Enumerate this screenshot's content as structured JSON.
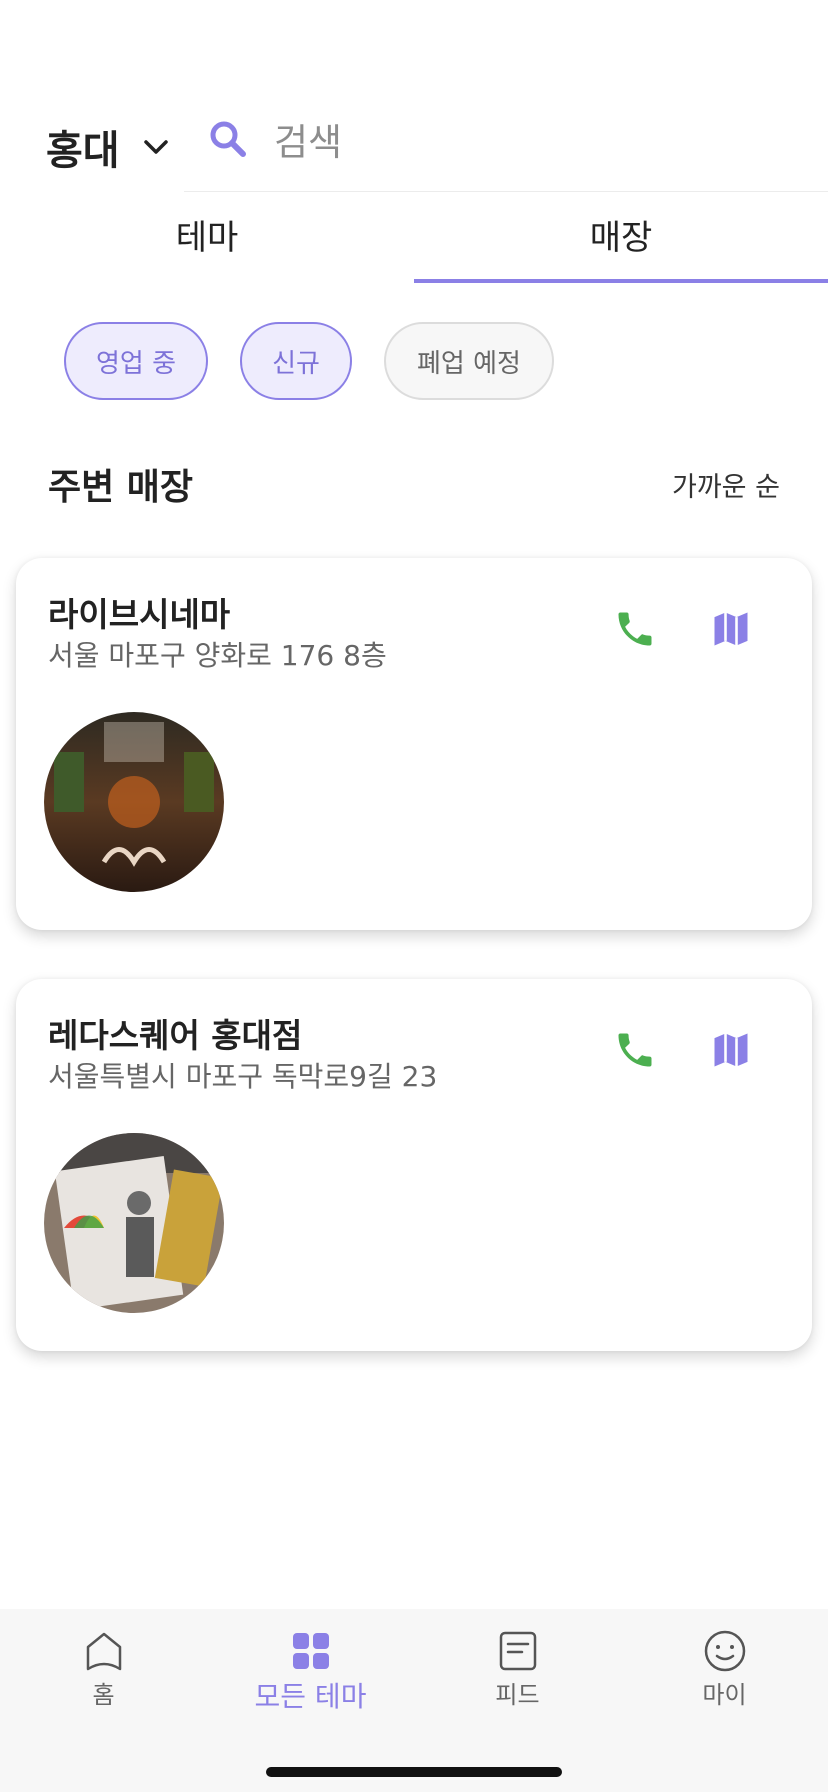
{
  "header": {
    "location": "홍대",
    "search_placeholder": "검색"
  },
  "tabs": [
    {
      "label": "테마",
      "active": false
    },
    {
      "label": "매장",
      "active": true
    }
  ],
  "filters": [
    {
      "label": "영업 중",
      "active": true
    },
    {
      "label": "신규",
      "active": true
    },
    {
      "label": "폐업 예정",
      "active": false
    }
  ],
  "section": {
    "title": "주변 매장",
    "sort": "가까운 순"
  },
  "stores": [
    {
      "name": "라이브시네마",
      "address": "서울 마포구 양화로 176 8층"
    },
    {
      "name": "레다스퀘어 홍대점",
      "address": "서울특별시 마포구 독막로9길 23"
    }
  ],
  "bottom_nav": [
    {
      "label": "홈",
      "icon": "home-icon"
    },
    {
      "label": "모든 테마",
      "icon": "grid-icon",
      "active": true
    },
    {
      "label": "피드",
      "icon": "feed-icon"
    },
    {
      "label": "마이",
      "icon": "smile-icon"
    }
  ],
  "colors": {
    "accent": "#8b80e6",
    "phone": "#4caf50"
  }
}
